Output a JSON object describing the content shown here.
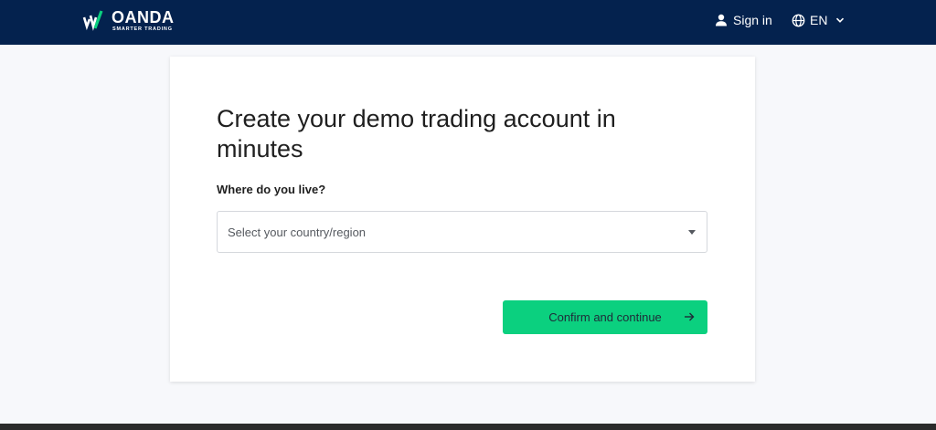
{
  "header": {
    "logo": {
      "name": "OANDA",
      "tagline": "SMARTER TRADING",
      "icon": "oanda-logo-mark"
    },
    "sign_in_label": "Sign in",
    "sign_in_icon": "person-icon",
    "language_label": "EN",
    "language_icon": "globe-icon",
    "background_color": "#04224e"
  },
  "form": {
    "title": "Create your demo trading account in minutes",
    "question": "Where do you live?",
    "country_select": {
      "placeholder": "Select your country/region"
    },
    "confirm_label": "Confirm and continue",
    "confirm_color": "#0bd07f"
  }
}
